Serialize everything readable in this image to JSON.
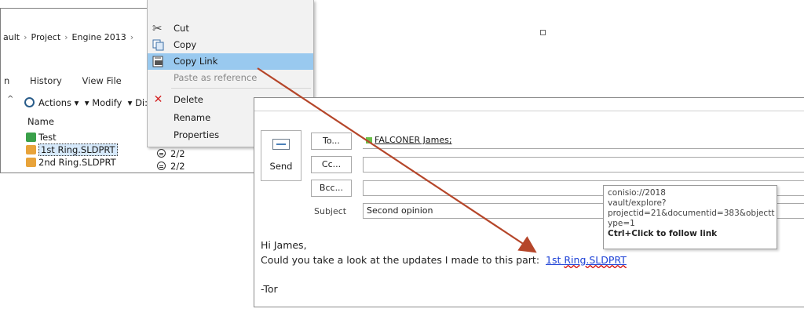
{
  "vault": {
    "breadcrumb": [
      "ault",
      "Project",
      "Engine 2013",
      ""
    ],
    "tabs": [
      "n",
      "History",
      "View File"
    ],
    "toolbar": {
      "actions": "Actions",
      "modify": "Modify",
      "di": "Di:"
    },
    "column_name": "Name",
    "rows": [
      {
        "name": "Test",
        "status": ""
      },
      {
        "name": "1st Ring.SLDPRT",
        "status": "2/2"
      },
      {
        "name": "2nd Ring.SLDPRT",
        "status": "2/2"
      }
    ]
  },
  "context_menu": {
    "items": [
      {
        "label": "Cut"
      },
      {
        "label": "Copy"
      },
      {
        "label": "Copy Link"
      },
      {
        "label": "Paste as reference"
      },
      {
        "label": "Delete"
      },
      {
        "label": "Rename"
      },
      {
        "label": "Properties"
      }
    ]
  },
  "email": {
    "send_label": "Send",
    "to_label": "To...",
    "cc_label": "Cc...",
    "bcc_label": "Bcc...",
    "subject_label": "Subject",
    "to_value": "FALCONER James;",
    "subject_value": "Second opinion",
    "body": {
      "greeting": "Hi James,",
      "line2": "Could you take a look at the updates I made to this part:",
      "link_a": "1st",
      "link_b": "Ring.SLDPRT",
      "signoff": "-Tor"
    }
  },
  "tooltip": {
    "line1": "conisio://2018",
    "line2": "vault/explore?",
    "line3": "projectid=21&documentid=383&objectt",
    "line4": "ype=1",
    "hint": "Ctrl+Click to follow link"
  },
  "colors": {
    "highlight": "#99c9ef",
    "link": "#1a3fd6",
    "arrow": "#b5462a",
    "delete_x": "#d42020"
  }
}
